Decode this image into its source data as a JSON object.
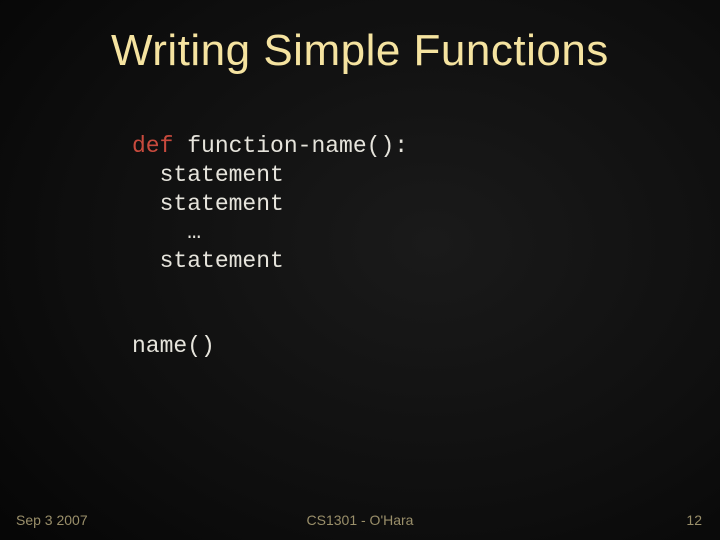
{
  "slide": {
    "title": "Writing Simple Functions",
    "code": {
      "def_keyword": "def",
      "def_rest": " function-name():",
      "lines": [
        "  statement",
        "  statement",
        "    …",
        "  statement"
      ],
      "call": "name()"
    },
    "footer": {
      "left": "Sep 3 2007",
      "center": "CS1301 - O'Hara",
      "right": "12"
    }
  }
}
